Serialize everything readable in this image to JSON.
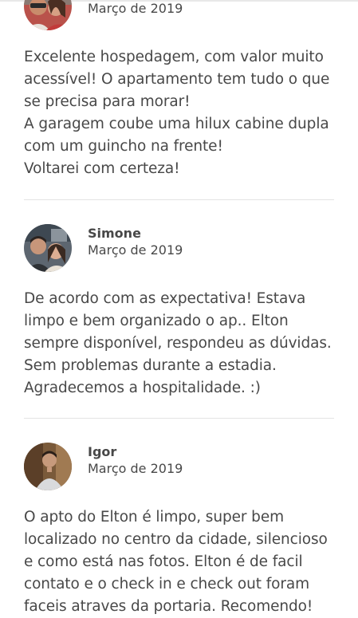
{
  "reviews": [
    {
      "name": "",
      "date": "Março de 2019",
      "avatar_icon": "couple-photo-avatar",
      "text": "Excelente hospedagem, com valor muito\nacessível! O apartamento tem tudo o que\nse precisa para morar!\nA garagem coube uma hilux cabine dupla\ncom um guincho na frente!\nVoltarei com certeza!"
    },
    {
      "name": "Simone",
      "date": "Março de 2019",
      "avatar_icon": "couple-photo-avatar",
      "text": "De acordo com as expectativa! Estava\nlimpo e bem organizado o ap.. Elton\nsempre disponível, respondeu as dúvidas.\nSem problemas durante a estadia.\nAgradecemos a hospitalidade. :)"
    },
    {
      "name": "Igor",
      "date": "Março de 2019",
      "avatar_icon": "man-photo-avatar",
      "text": "O apto do Elton é limpo, super bem\nlocalizado no centro da cidade, silencioso\ne como está nas fotos. Elton é de facil\ncontato e o check in e check out foram\nfaceis atraves da portaria. Recomendo!"
    }
  ],
  "colors": {
    "text": "#484848",
    "divider": "#e4e4e4"
  }
}
